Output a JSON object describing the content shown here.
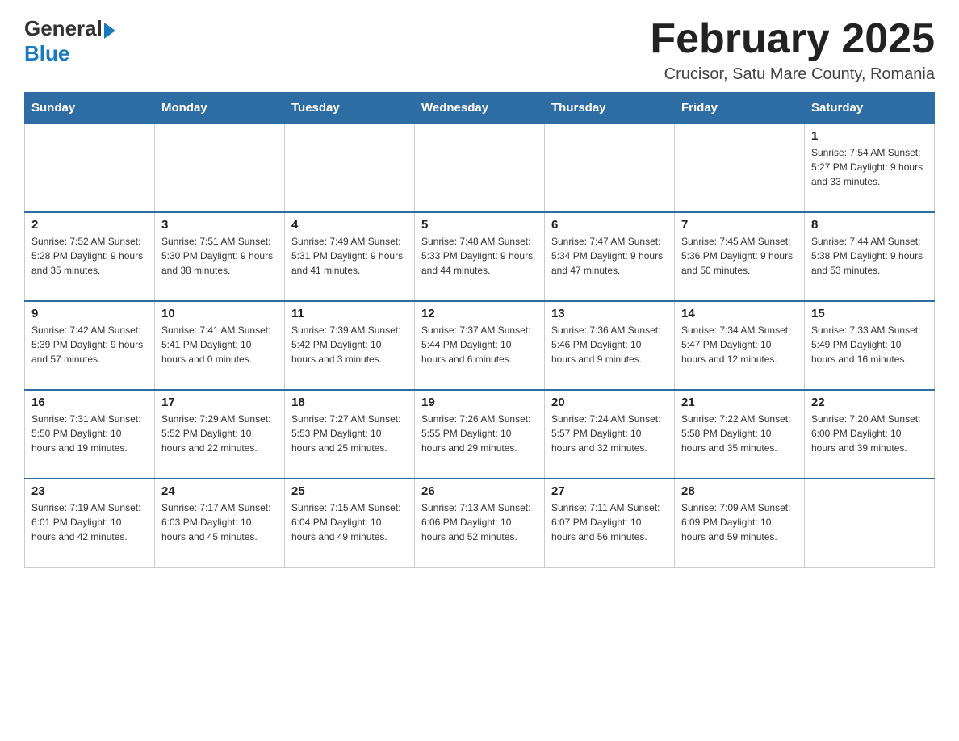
{
  "header": {
    "logo": {
      "general": "General",
      "arrow": "▶",
      "blue": "Blue"
    },
    "title": "February 2025",
    "subtitle": "Crucisor, Satu Mare County, Romania"
  },
  "weekdays": [
    "Sunday",
    "Monday",
    "Tuesday",
    "Wednesday",
    "Thursday",
    "Friday",
    "Saturday"
  ],
  "weeks": [
    [
      {
        "day": "",
        "info": ""
      },
      {
        "day": "",
        "info": ""
      },
      {
        "day": "",
        "info": ""
      },
      {
        "day": "",
        "info": ""
      },
      {
        "day": "",
        "info": ""
      },
      {
        "day": "",
        "info": ""
      },
      {
        "day": "1",
        "info": "Sunrise: 7:54 AM\nSunset: 5:27 PM\nDaylight: 9 hours and 33 minutes."
      }
    ],
    [
      {
        "day": "2",
        "info": "Sunrise: 7:52 AM\nSunset: 5:28 PM\nDaylight: 9 hours and 35 minutes."
      },
      {
        "day": "3",
        "info": "Sunrise: 7:51 AM\nSunset: 5:30 PM\nDaylight: 9 hours and 38 minutes."
      },
      {
        "day": "4",
        "info": "Sunrise: 7:49 AM\nSunset: 5:31 PM\nDaylight: 9 hours and 41 minutes."
      },
      {
        "day": "5",
        "info": "Sunrise: 7:48 AM\nSunset: 5:33 PM\nDaylight: 9 hours and 44 minutes."
      },
      {
        "day": "6",
        "info": "Sunrise: 7:47 AM\nSunset: 5:34 PM\nDaylight: 9 hours and 47 minutes."
      },
      {
        "day": "7",
        "info": "Sunrise: 7:45 AM\nSunset: 5:36 PM\nDaylight: 9 hours and 50 minutes."
      },
      {
        "day": "8",
        "info": "Sunrise: 7:44 AM\nSunset: 5:38 PM\nDaylight: 9 hours and 53 minutes."
      }
    ],
    [
      {
        "day": "9",
        "info": "Sunrise: 7:42 AM\nSunset: 5:39 PM\nDaylight: 9 hours and 57 minutes."
      },
      {
        "day": "10",
        "info": "Sunrise: 7:41 AM\nSunset: 5:41 PM\nDaylight: 10 hours and 0 minutes."
      },
      {
        "day": "11",
        "info": "Sunrise: 7:39 AM\nSunset: 5:42 PM\nDaylight: 10 hours and 3 minutes."
      },
      {
        "day": "12",
        "info": "Sunrise: 7:37 AM\nSunset: 5:44 PM\nDaylight: 10 hours and 6 minutes."
      },
      {
        "day": "13",
        "info": "Sunrise: 7:36 AM\nSunset: 5:46 PM\nDaylight: 10 hours and 9 minutes."
      },
      {
        "day": "14",
        "info": "Sunrise: 7:34 AM\nSunset: 5:47 PM\nDaylight: 10 hours and 12 minutes."
      },
      {
        "day": "15",
        "info": "Sunrise: 7:33 AM\nSunset: 5:49 PM\nDaylight: 10 hours and 16 minutes."
      }
    ],
    [
      {
        "day": "16",
        "info": "Sunrise: 7:31 AM\nSunset: 5:50 PM\nDaylight: 10 hours and 19 minutes."
      },
      {
        "day": "17",
        "info": "Sunrise: 7:29 AM\nSunset: 5:52 PM\nDaylight: 10 hours and 22 minutes."
      },
      {
        "day": "18",
        "info": "Sunrise: 7:27 AM\nSunset: 5:53 PM\nDaylight: 10 hours and 25 minutes."
      },
      {
        "day": "19",
        "info": "Sunrise: 7:26 AM\nSunset: 5:55 PM\nDaylight: 10 hours and 29 minutes."
      },
      {
        "day": "20",
        "info": "Sunrise: 7:24 AM\nSunset: 5:57 PM\nDaylight: 10 hours and 32 minutes."
      },
      {
        "day": "21",
        "info": "Sunrise: 7:22 AM\nSunset: 5:58 PM\nDaylight: 10 hours and 35 minutes."
      },
      {
        "day": "22",
        "info": "Sunrise: 7:20 AM\nSunset: 6:00 PM\nDaylight: 10 hours and 39 minutes."
      }
    ],
    [
      {
        "day": "23",
        "info": "Sunrise: 7:19 AM\nSunset: 6:01 PM\nDaylight: 10 hours and 42 minutes."
      },
      {
        "day": "24",
        "info": "Sunrise: 7:17 AM\nSunset: 6:03 PM\nDaylight: 10 hours and 45 minutes."
      },
      {
        "day": "25",
        "info": "Sunrise: 7:15 AM\nSunset: 6:04 PM\nDaylight: 10 hours and 49 minutes."
      },
      {
        "day": "26",
        "info": "Sunrise: 7:13 AM\nSunset: 6:06 PM\nDaylight: 10 hours and 52 minutes."
      },
      {
        "day": "27",
        "info": "Sunrise: 7:11 AM\nSunset: 6:07 PM\nDaylight: 10 hours and 56 minutes."
      },
      {
        "day": "28",
        "info": "Sunrise: 7:09 AM\nSunset: 6:09 PM\nDaylight: 10 hours and 59 minutes."
      },
      {
        "day": "",
        "info": ""
      }
    ]
  ]
}
